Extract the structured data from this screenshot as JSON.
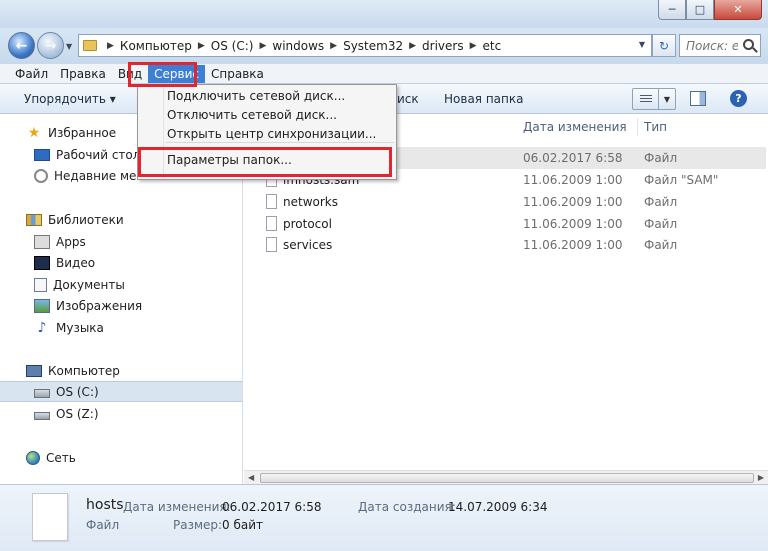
{
  "window": {
    "minimize_glyph": "─",
    "maximize_glyph": "□",
    "close_glyph": "✕"
  },
  "nav": {
    "back_glyph": "←",
    "forward_glyph": "→",
    "breadcrumbs": [
      "Компьютер",
      "OS (C:)",
      "windows",
      "System32",
      "drivers",
      "etc"
    ],
    "search_placeholder": "Поиск: etc"
  },
  "menubar": {
    "items": [
      "Файл",
      "Правка",
      "Вид",
      "Сервис",
      "Справка"
    ],
    "active": "Сервис"
  },
  "toolbar": {
    "organize": "Упорядочить ▾",
    "partial": "иск",
    "new_folder": "Новая папка"
  },
  "service_menu": {
    "items": [
      "Подключить сетевой диск...",
      "Отключить сетевой диск...",
      "Открыть центр синхронизации...",
      "Параметры папок..."
    ]
  },
  "sidebar": {
    "favorites": "Избранное",
    "desktop": "Рабочий стол",
    "recent": "Недавние места",
    "libraries": "Библиотеки",
    "apps": "Apps",
    "video": "Видео",
    "documents": "Документы",
    "images": "Изображения",
    "music": "Музыка",
    "computer": "Компьютер",
    "drive_c": "OS (C:)",
    "drive_z": "OS (Z:)",
    "network": "Сеть"
  },
  "columns": {
    "date": "Дата изменения",
    "type": "Тип"
  },
  "files": [
    {
      "name": "hosts",
      "date": "06.02.2017 6:58",
      "type": "Файл"
    },
    {
      "name": "lmhosts.sam",
      "date": "11.06.2009 1:00",
      "type": "Файл \"SAM\""
    },
    {
      "name": "networks",
      "date": "11.06.2009 1:00",
      "type": "Файл"
    },
    {
      "name": "protocol",
      "date": "11.06.2009 1:00",
      "type": "Файл"
    },
    {
      "name": "services",
      "date": "11.06.2009 1:00",
      "type": "Файл"
    }
  ],
  "details": {
    "name": "hosts",
    "modified_label": "Дата изменения:",
    "modified": "06.02.2017 6:58",
    "created_label": "Дата создания:",
    "created": "14.07.2009 6:34",
    "type": "Файл",
    "size_label": "Размер:",
    "size": "0 байт"
  },
  "colors": {
    "highlight": "#e3262d",
    "menu_active": "#3d7ed6"
  }
}
